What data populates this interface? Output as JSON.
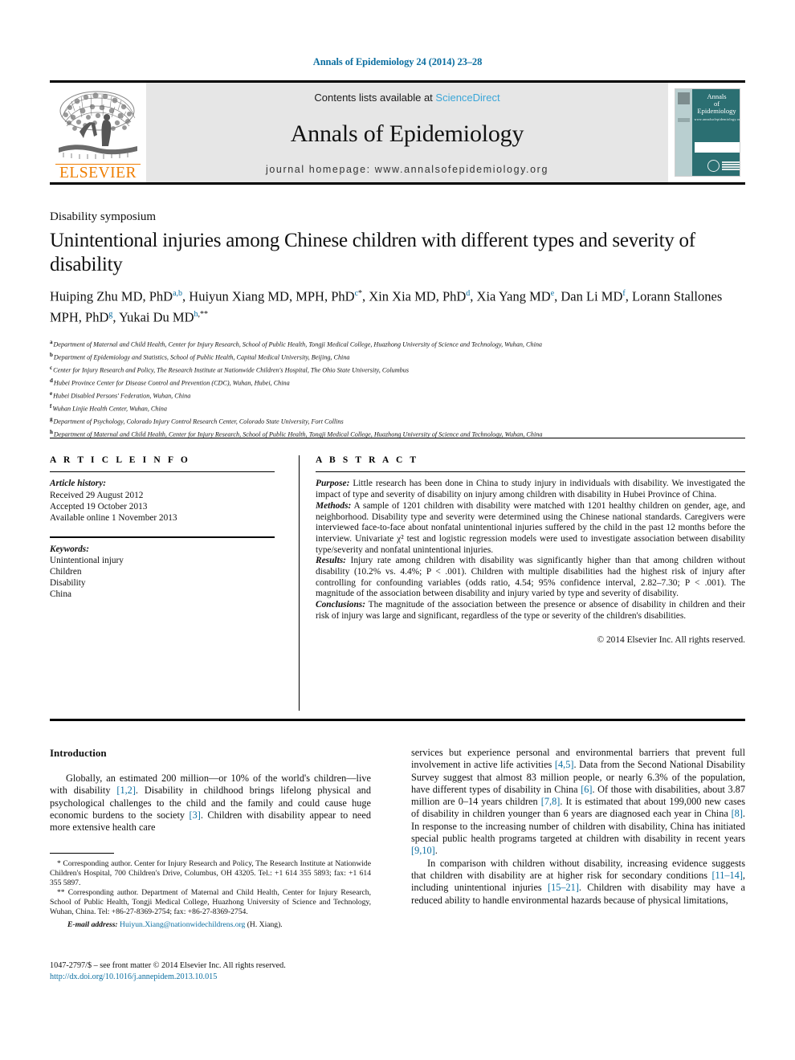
{
  "running_head": "Annals of Epidemiology 24 (2014) 23–28",
  "masthead": {
    "publisher_name": "ELSEVIER",
    "contents_prefix": "Contents lists available at ",
    "sciencedirect": "ScienceDirect",
    "journal_name": "Annals of Epidemiology",
    "homepage": "journal homepage: www.annalsofepidemiology.org",
    "cover": {
      "line1": "Annals",
      "line2": "of",
      "line3": "Epidemiology",
      "sub": "www.annalsofepidemiology.org"
    },
    "colors": {
      "elsevier_orange": "#ef7d00",
      "sciencedirect_blue": "#3aa6d8",
      "cover_teal": "#2b6f72",
      "band_gray": "#e6e6e6"
    }
  },
  "section_label": "Disability symposium",
  "title": "Unintentional injuries among Chinese children with different types and severity of disability",
  "authors_html": "Huiping Zhu MD, PhD<sup>a,b</sup>, Huiyun Xiang MD, MPH, PhD<sup>c</sup><sup class=\"star\">*</sup>, Xin Xia MD, PhD<sup>d</sup>, Xia Yang MD<sup>e</sup>, Dan Li MD<sup>f</sup>, Lorann Stallones MPH, PhD<sup>g</sup>, Yukai Du MD<sup>h</sup><sup class=\"star\">,**</sup>",
  "affiliations": [
    {
      "mark": "a",
      "text": "Department of Maternal and Child Health, Center for Injury Research, School of Public Health, Tongji Medical College, Huazhong University of Science and Technology, Wuhan, China"
    },
    {
      "mark": "b",
      "text": "Department of Epidemiology and Statistics, School of Public Health, Capital Medical University, Beijing, China"
    },
    {
      "mark": "c",
      "text": "Center for Injury Research and Policy, The Research Institute at Nationwide Children's Hospital, The Ohio State University, Columbus"
    },
    {
      "mark": "d",
      "text": "Hubei Province Center for Disease Control and Prevention (CDC), Wuhan, Hubei, China"
    },
    {
      "mark": "e",
      "text": "Hubei Disabled Persons' Federation, Wuhan, China"
    },
    {
      "mark": "f",
      "text": "Wuhan Linjie Health Center, Wuhan, China"
    },
    {
      "mark": "g",
      "text": "Department of Psychology, Colorado Injury Control Research Center, Colorado State University, Fort Collins"
    },
    {
      "mark": "h",
      "text": "Department of Maternal and Child Health, Center for Injury Research, School of Public Health, Tongji Medical College, Huazhong University of Science and Technology, Wuhan, China"
    }
  ],
  "article_info": {
    "heading": "A R T I C L E  I N F O",
    "history_label": "Article history:",
    "history": [
      "Received 29 August 2012",
      "Accepted 19 October 2013",
      "Available online 1 November 2013"
    ],
    "keywords_label": "Keywords:",
    "keywords": [
      "Unintentional injury",
      "Children",
      "Disability",
      "China"
    ]
  },
  "abstract": {
    "heading": "A B S T R A C T",
    "purpose_label": "Purpose:",
    "purpose": " Little research has been done in China to study injury in individuals with disability. We investigated the impact of type and severity of disability on injury among children with disability in Hubei Province of China.",
    "methods_label": "Methods:",
    "methods": " A sample of 1201 children with disability were matched with 1201 healthy children on gender, age, and neighborhood. Disability type and severity were determined using the Chinese national standards. Caregivers were interviewed face-to-face about nonfatal unintentional injuries suffered by the child in the past 12 months before the interview. Univariate χ² test and logistic regression models were used to investigate association between disability type/severity and nonfatal unintentional injuries.",
    "results_label": "Results:",
    "results": " Injury rate among children with disability was significantly higher than that among children without disability (10.2% vs. 4.4%; P < .001). Children with multiple disabilities had the highest risk of injury after controlling for confounding variables (odds ratio, 4.54; 95% confidence interval, 2.82–7.30; P < .001). The magnitude of the association between disability and injury varied by type and severity of disability.",
    "conclusions_label": "Conclusions:",
    "conclusions": " The magnitude of the association between the presence or absence of disability in children and their risk of injury was large and significant, regardless of the type or severity of the children's disabilities.",
    "copyright": "© 2014 Elsevier Inc. All rights reserved."
  },
  "body": {
    "intro_heading": "Introduction",
    "left_para_1": "Globally, an estimated 200 million—or 10% of the world's children—live with disability [1,2]. Disability in childhood brings lifelong physical and psychological challenges to the child and the family and could cause huge economic burdens to the society [3]. Children with disability appear to need more extensive health care",
    "right_para_1": "services but experience personal and environmental barriers that prevent full involvement in active life activities [4,5]. Data from the Second National Disability Survey suggest that almost 83 million people, or nearly 6.3% of the population, have different types of disability in China [6]. Of those with disabilities, about 3.87 million are 0–14 years children [7,8]. It is estimated that about 199,000 new cases of disability in children younger than 6 years are diagnosed each year in China [8]. In response to the increasing number of children with disability, China has initiated special public health programs targeted at children with disability in recent years [9,10].",
    "right_para_2": "In comparison with children without disability, increasing evidence suggests that children with disability are at higher risk for secondary conditions [11–14], including unintentional injuries [15–21]. Children with disability may have a reduced ability to handle environmental hazards because of physical limitations,"
  },
  "footnotes": {
    "corr1": "* Corresponding author. Center for Injury Research and Policy, The Research Institute at Nationwide Children's Hospital, 700 Children's Drive, Columbus, OH 43205. Tel.: +1 614 355 5893; fax: +1 614 355 5897.",
    "corr2": "** Corresponding author. Department of Maternal and Child Health, Center for Injury Research, School of Public Health, Tongji Medical College, Huazhong University of Science and Technology, Wuhan, China. Tel: +86-27-8369-2754; fax: +86-27-8369-2754.",
    "email_label": "E-mail address:",
    "email": "Huiyun.Xiang@nationwidechildrens.org",
    "email_attrib": "(H. Xiang)."
  },
  "issn_line": "1047-2797/$ – see front matter © 2014 Elsevier Inc. All rights reserved.",
  "doi": "http://dx.doi.org/10.1016/j.annepidem.2013.10.015"
}
